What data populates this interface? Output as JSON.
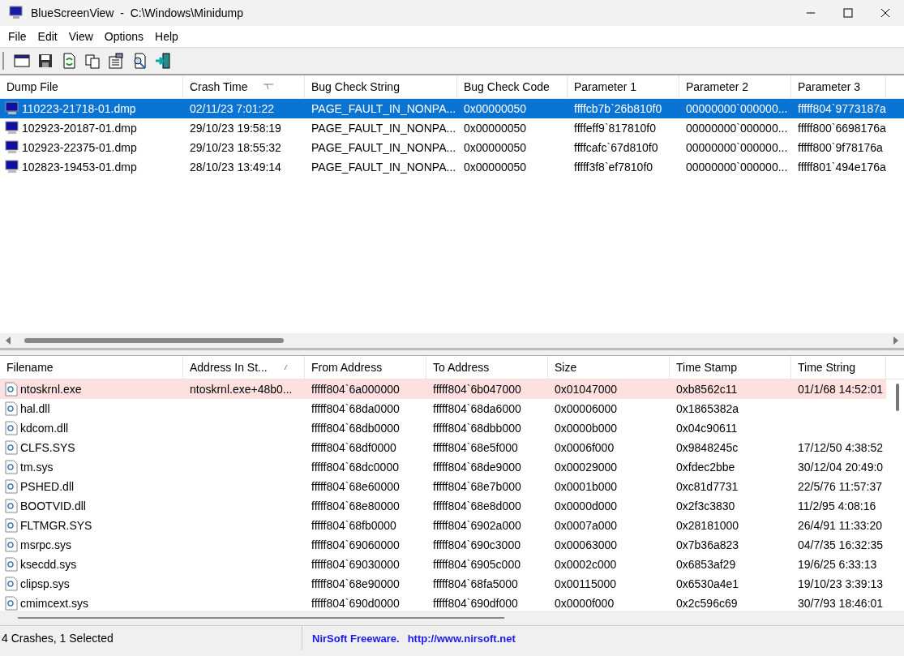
{
  "window": {
    "title": "BlueScreenView  -  C:\\Windows\\Minidump"
  },
  "menu": [
    "File",
    "Edit",
    "View",
    "Options",
    "Help"
  ],
  "crash_list": {
    "columns": [
      {
        "label": "Dump File",
        "sorted": false
      },
      {
        "label": "Crash Time",
        "sorted": true
      },
      {
        "label": "Bug Check String",
        "sorted": false
      },
      {
        "label": "Bug Check Code",
        "sorted": false
      },
      {
        "label": "Parameter 1",
        "sorted": false
      },
      {
        "label": "Parameter 2",
        "sorted": false
      },
      {
        "label": "Parameter 3",
        "sorted": false
      }
    ],
    "rows": [
      {
        "selected": true,
        "cells": [
          "110223-21718-01.dmp",
          "02/11/23 7:01:22",
          "PAGE_FAULT_IN_NONPA...",
          "0x00000050",
          "ffffcb7b`26b810f0",
          "00000000`000000...",
          "fffff804`9773187a"
        ]
      },
      {
        "selected": false,
        "cells": [
          "102923-20187-01.dmp",
          "29/10/23 19:58:19",
          "PAGE_FAULT_IN_NONPA...",
          "0x00000050",
          "ffffeff9`817810f0",
          "00000000`000000...",
          "fffff800`6698176a"
        ]
      },
      {
        "selected": false,
        "cells": [
          "102923-22375-01.dmp",
          "29/10/23 18:55:32",
          "PAGE_FAULT_IN_NONPA...",
          "0x00000050",
          "ffffcafc`67d810f0",
          "00000000`000000...",
          "fffff800`9f78176a"
        ]
      },
      {
        "selected": false,
        "cells": [
          "102823-19453-01.dmp",
          "28/10/23 13:49:14",
          "PAGE_FAULT_IN_NONPA...",
          "0x00000050",
          "fffff3f8`ef7810f0",
          "00000000`000000...",
          "fffff801`494e176a"
        ]
      }
    ]
  },
  "module_list": {
    "columns": [
      {
        "label": "Filename",
        "sorted": false
      },
      {
        "label": "Address In St...",
        "sorted": true
      },
      {
        "label": "From Address",
        "sorted": false
      },
      {
        "label": "To Address",
        "sorted": false
      },
      {
        "label": "Size",
        "sorted": false
      },
      {
        "label": "Time Stamp",
        "sorted": false
      },
      {
        "label": "Time String",
        "sorted": false
      }
    ],
    "rows": [
      {
        "highlighted": true,
        "cells": [
          "ntoskrnl.exe",
          "ntoskrnl.exe+48b0...",
          "fffff804`6a000000",
          "fffff804`6b047000",
          "0x01047000",
          "0xb8562c11",
          "01/1/68 14:52:01"
        ]
      },
      {
        "highlighted": false,
        "cells": [
          "hal.dll",
          "",
          "fffff804`68da0000",
          "fffff804`68da6000",
          "0x00006000",
          "0x1865382a",
          ""
        ]
      },
      {
        "highlighted": false,
        "cells": [
          "kdcom.dll",
          "",
          "fffff804`68db0000",
          "fffff804`68dbb000",
          "0x0000b000",
          "0x04c90611",
          ""
        ]
      },
      {
        "highlighted": false,
        "cells": [
          "CLFS.SYS",
          "",
          "fffff804`68df0000",
          "fffff804`68e5f000",
          "0x0006f000",
          "0x9848245c",
          "17/12/50 4:38:52"
        ]
      },
      {
        "highlighted": false,
        "cells": [
          "tm.sys",
          "",
          "fffff804`68dc0000",
          "fffff804`68de9000",
          "0x00029000",
          "0xfdec2bbe",
          "30/12/04 20:49:0"
        ]
      },
      {
        "highlighted": false,
        "cells": [
          "PSHED.dll",
          "",
          "fffff804`68e60000",
          "fffff804`68e7b000",
          "0x0001b000",
          "0xc81d7731",
          "22/5/76 11:57:37"
        ]
      },
      {
        "highlighted": false,
        "cells": [
          "BOOTVID.dll",
          "",
          "fffff804`68e80000",
          "fffff804`68e8d000",
          "0x0000d000",
          "0x2f3c3830",
          "11/2/95 4:08:16"
        ]
      },
      {
        "highlighted": false,
        "cells": [
          "FLTMGR.SYS",
          "",
          "fffff804`68fb0000",
          "fffff804`6902a000",
          "0x0007a000",
          "0x28181000",
          "26/4/91 11:33:20"
        ]
      },
      {
        "highlighted": false,
        "cells": [
          "msrpc.sys",
          "",
          "fffff804`69060000",
          "fffff804`690c3000",
          "0x00063000",
          "0x7b36a823",
          "04/7/35 16:32:35"
        ]
      },
      {
        "highlighted": false,
        "cells": [
          "ksecdd.sys",
          "",
          "fffff804`69030000",
          "fffff804`6905c000",
          "0x0002c000",
          "0x6853af29",
          "19/6/25 6:33:13"
        ]
      },
      {
        "highlighted": false,
        "cells": [
          "clipsp.sys",
          "",
          "fffff804`68e90000",
          "fffff804`68fa5000",
          "0x00115000",
          "0x6530a4e1",
          "19/10/23 3:39:13"
        ]
      },
      {
        "highlighted": false,
        "cells": [
          "cmimcext.sys",
          "",
          "fffff804`690d0000",
          "fffff804`690df000",
          "0x0000f000",
          "0x2c596c69",
          "30/7/93 18:46:01"
        ]
      }
    ]
  },
  "status_bar": {
    "count": "4 Crashes, 1 Selected",
    "credit": "NirSoft Freeware.",
    "link": "http://www.nirsoft.net"
  }
}
